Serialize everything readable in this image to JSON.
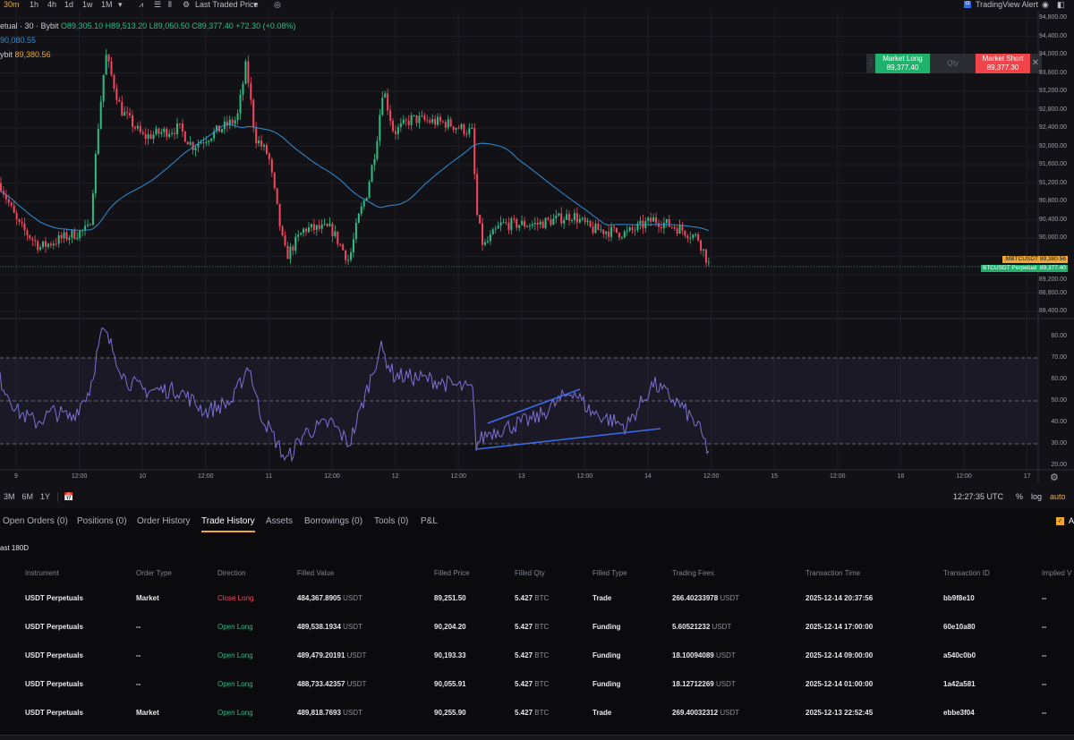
{
  "toolbar": {
    "timeframes": [
      "30m",
      "1h",
      "4h",
      "1d",
      "1w",
      "1M"
    ],
    "active_timeframe": "30m",
    "price_source": "Last Traded Price",
    "alert": "TradingView Alert"
  },
  "legend": {
    "symbol": "etual · 30 · Bybit",
    "open": "O89,305.10",
    "high": "H89,513.20",
    "low": "L89,050.50",
    "close": "C89,377.40",
    "change": "+72.30 (+0.08%)",
    "ma_value": "90,080.55",
    "index_label": "ybit",
    "index_value": "89,380.56"
  },
  "trade_panel": {
    "long_label": "Market Long",
    "long_price": "89,377.40",
    "qty_placeholder": "Qty",
    "short_label": "Market Short",
    "short_price": "89,377.30"
  },
  "price_axis": [
    "94,800.00",
    "94,400.00",
    "94,000.00",
    "93,600.00",
    "93,200.00",
    "92,800.00",
    "92,400.00",
    "92,000.00",
    "91,600.00",
    "91,200.00",
    "90,800.00",
    "90,400.00",
    "90,000.00",
    "89,200.00",
    "88,800.00",
    "88,400.00"
  ],
  "price_tags": {
    "index_name": ".MBTCUSDT",
    "index_price": "89,380.56",
    "symbol_name": "BTCUSDT Perpetual",
    "symbol_price": "89,377.40"
  },
  "rsi_axis": [
    "80.00",
    "70.00",
    "60.00",
    "50.00",
    "40.00",
    "30.00",
    "20.00"
  ],
  "time_axis": [
    "9",
    "12:00",
    "10",
    "12:00",
    "11",
    "12:00",
    "12",
    "12:00",
    "13",
    "12:00",
    "14",
    "12:00",
    "15",
    "12:00",
    "16",
    "12:00",
    "17"
  ],
  "chart": {
    "price_path": [
      [
        0,
        91200
      ],
      [
        20,
        90300
      ],
      [
        45,
        89800
      ],
      [
        70,
        90000
      ],
      [
        100,
        90200
      ],
      [
        110,
        92500
      ],
      [
        118,
        94000
      ],
      [
        125,
        93500
      ],
      [
        135,
        92800
      ],
      [
        160,
        92200
      ],
      [
        200,
        92400
      ],
      [
        215,
        92000
      ],
      [
        240,
        92300
      ],
      [
        265,
        92600
      ],
      [
        275,
        93800
      ],
      [
        285,
        92200
      ],
      [
        300,
        91800
      ],
      [
        315,
        90000
      ],
      [
        320,
        89600
      ],
      [
        340,
        90200
      ],
      [
        370,
        90200
      ],
      [
        390,
        89500
      ],
      [
        400,
        90400
      ],
      [
        410,
        91000
      ],
      [
        420,
        92000
      ],
      [
        428,
        93300
      ],
      [
        440,
        92300
      ],
      [
        460,
        92600
      ],
      [
        500,
        92500
      ],
      [
        528,
        92300
      ],
      [
        532,
        90600
      ],
      [
        540,
        89800
      ],
      [
        560,
        90300
      ],
      [
        600,
        90300
      ],
      [
        640,
        90500
      ],
      [
        660,
        90200
      ],
      [
        700,
        90100
      ],
      [
        730,
        90400
      ],
      [
        760,
        90200
      ],
      [
        780,
        90000
      ],
      [
        793,
        89377
      ]
    ],
    "rsi_path": [
      [
        0,
        60
      ],
      [
        20,
        45
      ],
      [
        40,
        40
      ],
      [
        60,
        45
      ],
      [
        80,
        42
      ],
      [
        100,
        55
      ],
      [
        110,
        75
      ],
      [
        115,
        83
      ],
      [
        125,
        75
      ],
      [
        140,
        60
      ],
      [
        160,
        55
      ],
      [
        200,
        55
      ],
      [
        230,
        45
      ],
      [
        260,
        50
      ],
      [
        278,
        67
      ],
      [
        290,
        45
      ],
      [
        310,
        30
      ],
      [
        320,
        22
      ],
      [
        340,
        35
      ],
      [
        370,
        40
      ],
      [
        390,
        30
      ],
      [
        400,
        42
      ],
      [
        410,
        55
      ],
      [
        425,
        75
      ],
      [
        440,
        62
      ],
      [
        480,
        60
      ],
      [
        528,
        55
      ],
      [
        532,
        30
      ],
      [
        545,
        35
      ],
      [
        600,
        42
      ],
      [
        640,
        55
      ],
      [
        660,
        45
      ],
      [
        700,
        38
      ],
      [
        730,
        58
      ],
      [
        760,
        48
      ],
      [
        780,
        38
      ],
      [
        793,
        25
      ]
    ],
    "colors": {
      "up": "#2ebd85",
      "down": "#f6465d",
      "ma": "#2e8fd8",
      "rsi": "#7e6fd6",
      "trendline": "#3d6cf0"
    }
  },
  "bottom_bar": {
    "ranges": [
      "3M",
      "6M",
      "1Y"
    ],
    "clock": "12:27:35 UTC",
    "percent": "%",
    "log": "log",
    "auto": "auto"
  },
  "tabs": [
    "Open Orders (0)",
    "Positions (0)",
    "Order History",
    "Trade History",
    "Assets",
    "Borrowings (0)",
    "Tools (0)",
    "P&L"
  ],
  "active_tab": "Trade History",
  "filter": "ast 180D",
  "checkbox_label": "A",
  "table": {
    "headers": [
      "Instrument",
      "Order Type",
      "Direction",
      "Filled Value",
      "Filled Price",
      "Filled Qty",
      "Filled Type",
      "Trading Fees",
      "Transaction Time",
      "Transaction ID",
      "Implied V"
    ],
    "rows": [
      {
        "instrument": "USDT Perpetuals",
        "order_type": "Market",
        "direction": "Close Long",
        "filled_value": "484,367.8905",
        "value_unit": "USDT",
        "filled_price": "89,251.50",
        "qty": "5.427",
        "qty_unit": "BTC",
        "filled_type": "Trade",
        "fees": "266.40233978",
        "fee_unit": "USDT",
        "time": "2025-12-14 20:37:56",
        "id": "bb9f8e10",
        "implied": "--"
      },
      {
        "instrument": "USDT Perpetuals",
        "order_type": "--",
        "direction": "Open Long",
        "filled_value": "489,538.1934",
        "value_unit": "USDT",
        "filled_price": "90,204.20",
        "qty": "5.427",
        "qty_unit": "BTC",
        "filled_type": "Funding",
        "fees": "5.60521232",
        "fee_unit": "USDT",
        "time": "2025-12-14 17:00:00",
        "id": "60e10a80",
        "implied": "--"
      },
      {
        "instrument": "USDT Perpetuals",
        "order_type": "--",
        "direction": "Open Long",
        "filled_value": "489,479.20191",
        "value_unit": "USDT",
        "filled_price": "90,193.33",
        "qty": "5.427",
        "qty_unit": "BTC",
        "filled_type": "Funding",
        "fees": "18.10094089",
        "fee_unit": "USDT",
        "time": "2025-12-14 09:00:00",
        "id": "a540c0b0",
        "implied": "--"
      },
      {
        "instrument": "USDT Perpetuals",
        "order_type": "--",
        "direction": "Open Long",
        "filled_value": "488,733.42357",
        "value_unit": "USDT",
        "filled_price": "90,055.91",
        "qty": "5.427",
        "qty_unit": "BTC",
        "filled_type": "Funding",
        "fees": "18.12712269",
        "fee_unit": "USDT",
        "time": "2025-12-14 01:00:00",
        "id": "1a42a581",
        "implied": "--"
      },
      {
        "instrument": "USDT Perpetuals",
        "order_type": "Market",
        "direction": "Open Long",
        "filled_value": "489,818.7693",
        "value_unit": "USDT",
        "filled_price": "90,255.90",
        "qty": "5.427",
        "qty_unit": "BTC",
        "filled_type": "Trade",
        "fees": "269.40032312",
        "fee_unit": "USDT",
        "time": "2025-12-13 22:52:45",
        "id": "ebbe3f04",
        "implied": "--"
      }
    ]
  }
}
